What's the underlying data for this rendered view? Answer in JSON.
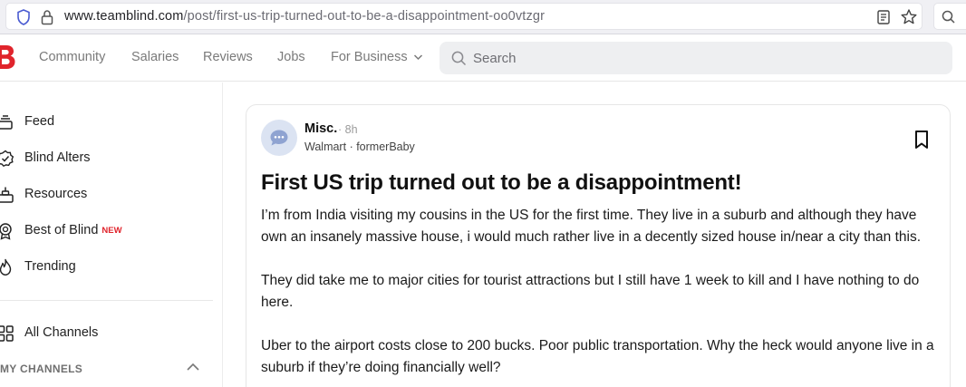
{
  "browser": {
    "url_host": "www.teamblind.com",
    "url_path": "/post/first-us-trip-turned-out-to-be-a-disappointment-oo0vtzgr"
  },
  "header": {
    "logo_icon": "blind-logo-icon",
    "nav": [
      "Community",
      "Salaries",
      "Reviews",
      "Jobs",
      "For Business"
    ],
    "search_placeholder": "Search"
  },
  "sidebar": {
    "items": [
      {
        "label": "Feed",
        "icon": "feed-icon"
      },
      {
        "label": "Blind Alters",
        "icon": "badge-check-icon"
      },
      {
        "label": "Resources",
        "icon": "resources-icon"
      },
      {
        "label": "Best of Blind",
        "icon": "award-icon",
        "badge": "NEW"
      },
      {
        "label": "Trending",
        "icon": "flame-icon"
      }
    ],
    "all_channels": "All Channels",
    "section_label": "MY CHANNELS"
  },
  "post": {
    "channel": "Misc.",
    "time": "· 8h",
    "company": "Walmart",
    "author": "· formerBaby",
    "title": "First US trip turned out to be a disappointment!",
    "paragraphs": [
      "I’m from India visiting my cousins in the US for the first time. They live in a suburb and although they have own an insanely massive house, i would much rather live in a decently sized house in/near a city than this.",
      "They did take me to major cities for tourist attractions but I still have 1 week to kill and I have nothing to do here.",
      "Uber to the airport costs close to 200 bucks. Poor public transportation. Why the heck would anyone live in a suburb if they’re doing financially well?"
    ]
  },
  "colors": {
    "brand": "#e0242c",
    "search_bg": "#eeeff1",
    "avatar_bg": "#dbe3f2"
  }
}
